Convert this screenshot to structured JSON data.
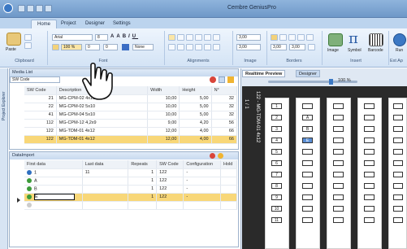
{
  "app": {
    "title": "Cembre GeniusPro"
  },
  "ribbon_tabs": [
    "Home",
    "Project",
    "Designer",
    "Settings"
  ],
  "ribbon": {
    "font_name": "Arial",
    "font_size": "8",
    "zoom": "100 %",
    "spacing_1": "0",
    "spacing_2": "0",
    "color_none": "None",
    "dim_1": "3,00",
    "dim_2": "3,00",
    "dim_3": "3,00",
    "dim_4": "3,00",
    "btn_paste": "Paste",
    "btn_image": "Image",
    "btn_symbol": "Symbol",
    "btn_barcode": "Barcode",
    "btn_run": "Run",
    "groups": [
      "Clipboard",
      "Font",
      "Alignments",
      "Image",
      "Borders",
      "Insert",
      "Ext Ap"
    ]
  },
  "sidebar": {
    "label": "Project Explorer"
  },
  "media_list": {
    "title": "Media List",
    "filter_value": "SW Code",
    "columns": [
      "SW Code",
      "Description",
      "Width",
      "Height",
      "N°"
    ],
    "rows": [
      [
        "21",
        "MG-CPM-02 4x10",
        "10,00",
        "5,00",
        "32"
      ],
      [
        "22",
        "MG-CPM-02 5x10",
        "10,00",
        "5,00",
        "32"
      ],
      [
        "41",
        "MG-CPM-04 5x10",
        "10,00",
        "5,00",
        "32"
      ],
      [
        "112",
        "MG-CPM-12 4,2x9",
        "9,00",
        "4,20",
        "56"
      ],
      [
        "122",
        "MG-TDM-01 4x12",
        "12,00",
        "4,00",
        "66"
      ],
      [
        "122",
        "MG-TDM-01 4x12",
        "12,00",
        "4,00",
        "66"
      ]
    ]
  },
  "data_import": {
    "title": "DataImport",
    "columns": [
      "First data",
      "Last data",
      "Repeats",
      "SW Code",
      "Configuration",
      "Hold"
    ],
    "rows": [
      {
        "first": "1",
        "last": "11",
        "repeats": "1",
        "sw": "122",
        "config": "-"
      },
      {
        "first": "A",
        "last": "",
        "repeats": "1",
        "sw": "122",
        "config": "-"
      },
      {
        "first": "B",
        "last": "",
        "repeats": "1",
        "sw": "122",
        "config": "-"
      },
      {
        "first": "E",
        "last": "",
        "repeats": "1",
        "sw": "122",
        "config": "-"
      }
    ]
  },
  "preview": {
    "tab_realtime": "Realtime Preview",
    "tab_designer": "Designer",
    "zoom_label": "100 %",
    "page_label": "1 / 1",
    "vertical_label": "122 - MG-TDM-01 4x12",
    "numbers": [
      "1",
      "2",
      "3",
      "4",
      "5",
      "6",
      "7",
      "8",
      "9",
      "10",
      "11"
    ],
    "col2_values": [
      "",
      "A",
      "B",
      "E"
    ]
  },
  "colors": {
    "accent": "#3b78c4",
    "selection": "#f8d778",
    "dark": "#2a2a2a"
  }
}
